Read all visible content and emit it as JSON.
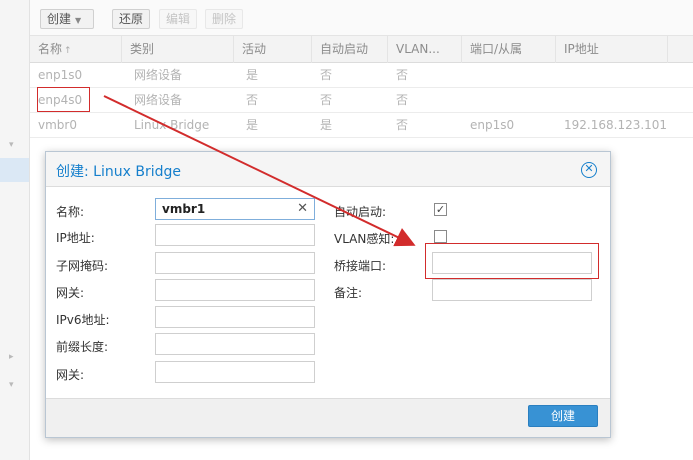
{
  "toolbar": {
    "create_label": "创建",
    "revert_label": "还原",
    "edit_label": "编辑",
    "delete_label": "删除"
  },
  "grid": {
    "columns": [
      "名称",
      "类别",
      "活动",
      "自动启动",
      "VLAN...",
      "端口/从属",
      "IP地址"
    ],
    "rows": [
      [
        "enp1s0",
        "网络设备",
        "是",
        "否",
        "否",
        "",
        ""
      ],
      [
        "enp4s0",
        "网络设备",
        "否",
        "否",
        "否",
        "",
        ""
      ],
      [
        "vmbr0",
        "Linux Bridge",
        "是",
        "是",
        "否",
        "enp1s0",
        "192.168.123.101"
      ]
    ]
  },
  "dialog": {
    "title": "创建: Linux Bridge",
    "labels": {
      "name": "名称:",
      "ip": "IP地址:",
      "subnet": "子网掩码:",
      "gateway": "网关:",
      "ipv6": "IPv6地址:",
      "prefix": "前缀长度:",
      "gateway6": "网关:",
      "autostart": "自动启动:",
      "vlan_aware": "VLAN感知:",
      "bridge_ports": "桥接端口:",
      "comment": "备注:"
    },
    "name_value": "vmbr1",
    "autostart_checked": true,
    "vlan_aware_checked": false,
    "create_button": "创建"
  },
  "colors": {
    "accent": "#157fcc",
    "annotation": "#d22c2c",
    "primary_button": "#3892d4"
  }
}
